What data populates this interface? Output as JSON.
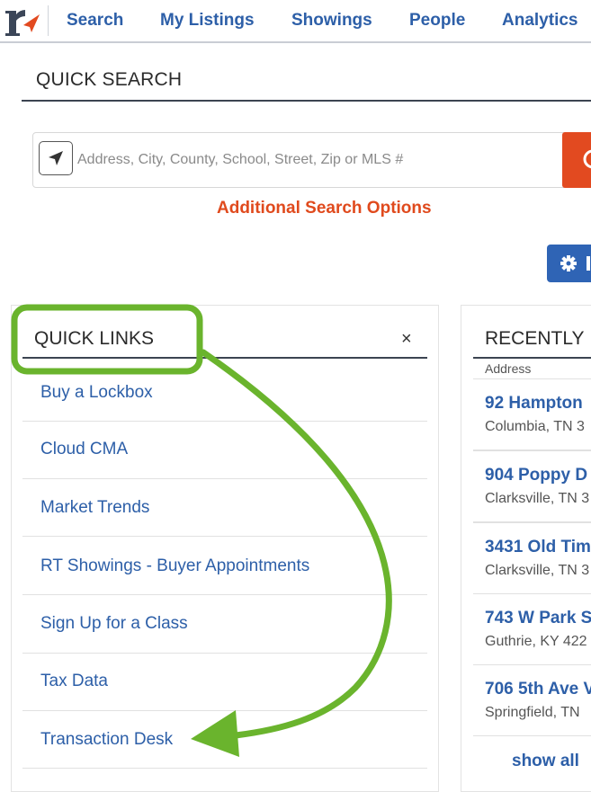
{
  "nav": {
    "items": [
      "Search",
      "My Listings",
      "Showings",
      "People",
      "Analytics"
    ]
  },
  "quick_search": {
    "title": "QUICK SEARCH",
    "placeholder": "Address, City, County, School, Street, Zip or MLS #",
    "additional_options": "Additional Search Options"
  },
  "quick_links": {
    "title": "QUICK LINKS",
    "close": "×",
    "items": [
      "Buy a Lockbox",
      "Cloud CMA",
      "Market Trends",
      "RT Showings - Buyer Appointments",
      "Sign Up for a Class",
      "Tax Data",
      "Transaction Desk"
    ]
  },
  "recently_viewed": {
    "title": "RECENTLY",
    "column": "Address",
    "rows": [
      {
        "address": "92 Hampton",
        "city": "Columbia, TN 3"
      },
      {
        "address": "904 Poppy D",
        "city": "Clarksville, TN 3"
      },
      {
        "address": "3431 Old Tim",
        "city": "Clarksville, TN 3"
      },
      {
        "address": "743 W Park S",
        "city": "Guthrie, KY 422"
      },
      {
        "address": "706 5th Ave V",
        "city": "Springfield, TN"
      }
    ],
    "show_all": "show all"
  },
  "colors": {
    "link_blue": "#2d5fa8",
    "accent_orange": "#e24a20",
    "annotation_green": "#6ab42d"
  },
  "icons": {
    "logo": "realtracs-r-logo",
    "locate": "location-arrow-icon",
    "gear": "gear-icon"
  }
}
